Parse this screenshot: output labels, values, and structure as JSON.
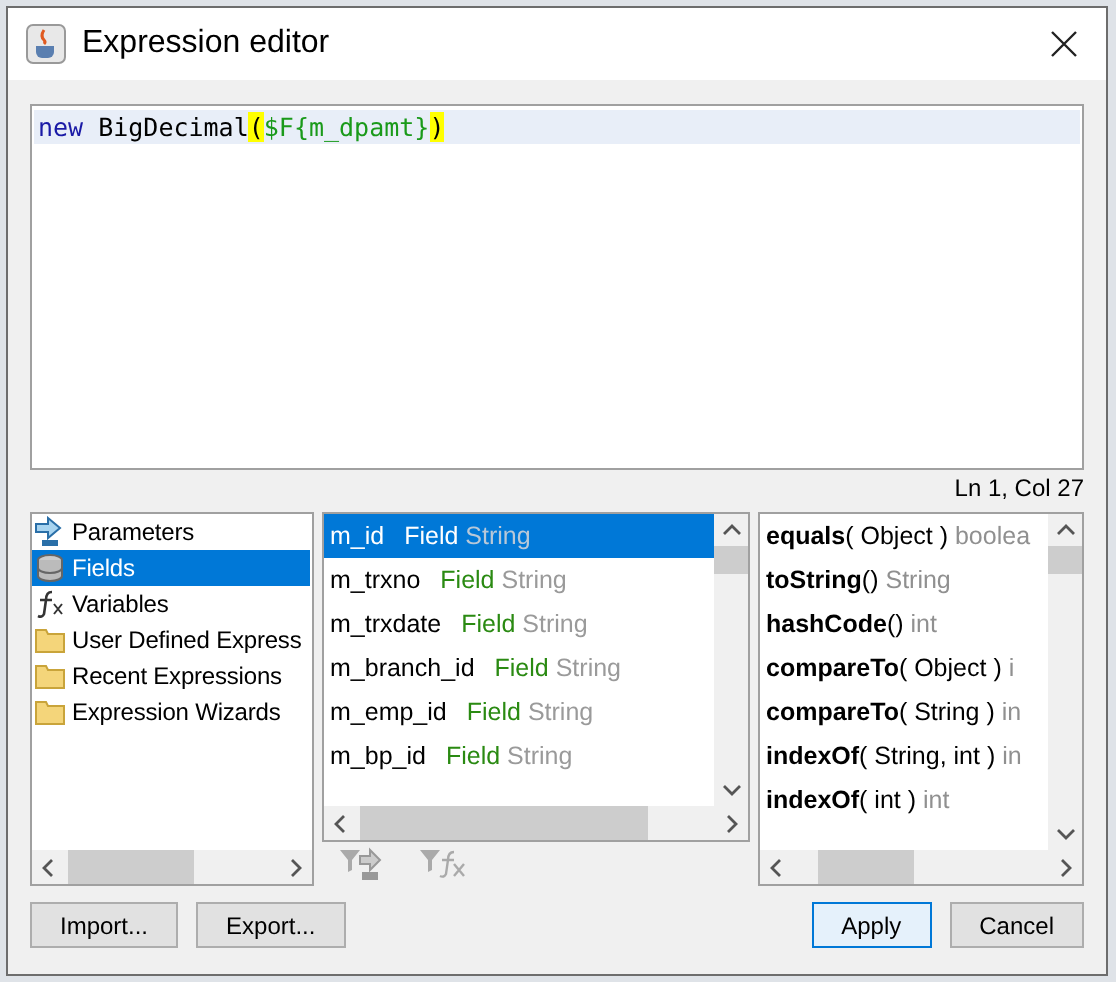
{
  "window": {
    "title": "Expression editor"
  },
  "editor": {
    "tokens": [
      {
        "kind": "keyword",
        "text": "new"
      },
      {
        "kind": "plain",
        "text": " BigDecimal"
      },
      {
        "kind": "bracket",
        "text": "("
      },
      {
        "kind": "field",
        "text": "$F{m_dpamt}"
      },
      {
        "kind": "bracket",
        "text": ")"
      }
    ]
  },
  "status": "Ln 1, Col 27",
  "categories": [
    {
      "kind": "parameters",
      "label": "Parameters",
      "selected": false
    },
    {
      "kind": "fields",
      "label": "Fields",
      "selected": true
    },
    {
      "kind": "variables",
      "label": "Variables",
      "selected": false
    },
    {
      "kind": "folder",
      "label": "User Defined Express",
      "selected": false
    },
    {
      "kind": "folder",
      "label": "Recent Expressions",
      "selected": false
    },
    {
      "kind": "folder",
      "label": "Expression Wizards",
      "selected": false
    }
  ],
  "fields": [
    {
      "name": "m_id",
      "kind": "Field",
      "type": "String",
      "selected": true
    },
    {
      "name": "m_trxno",
      "kind": "Field",
      "type": "String",
      "selected": false
    },
    {
      "name": "m_trxdate",
      "kind": "Field",
      "type": "String",
      "selected": false
    },
    {
      "name": "m_branch_id",
      "kind": "Field",
      "type": "String",
      "selected": false
    },
    {
      "name": "m_emp_id",
      "kind": "Field",
      "type": "String",
      "selected": false
    },
    {
      "name": "m_bp_id",
      "kind": "Field",
      "type": "String",
      "selected": false
    }
  ],
  "methods": [
    {
      "name": "equals",
      "params": "( Object )",
      "returns": "boolea"
    },
    {
      "name": "toString",
      "params": "()",
      "returns": "String"
    },
    {
      "name": "hashCode",
      "params": "()",
      "returns": "int"
    },
    {
      "name": "compareTo",
      "params": "( Object )",
      "returns": "i"
    },
    {
      "name": "compareTo",
      "params": "( String )",
      "returns": "in"
    },
    {
      "name": "indexOf",
      "params": "( String, int )",
      "returns": "in"
    },
    {
      "name": "indexOf",
      "params": "( int )",
      "returns": "int"
    }
  ],
  "buttons": [
    {
      "label": "Import...",
      "kind": "left",
      "default": false
    },
    {
      "label": "Export...",
      "kind": "left",
      "default": false
    },
    {
      "label": "Apply",
      "kind": "right",
      "default": true
    },
    {
      "label": "Cancel",
      "kind": "right",
      "default": false
    }
  ]
}
